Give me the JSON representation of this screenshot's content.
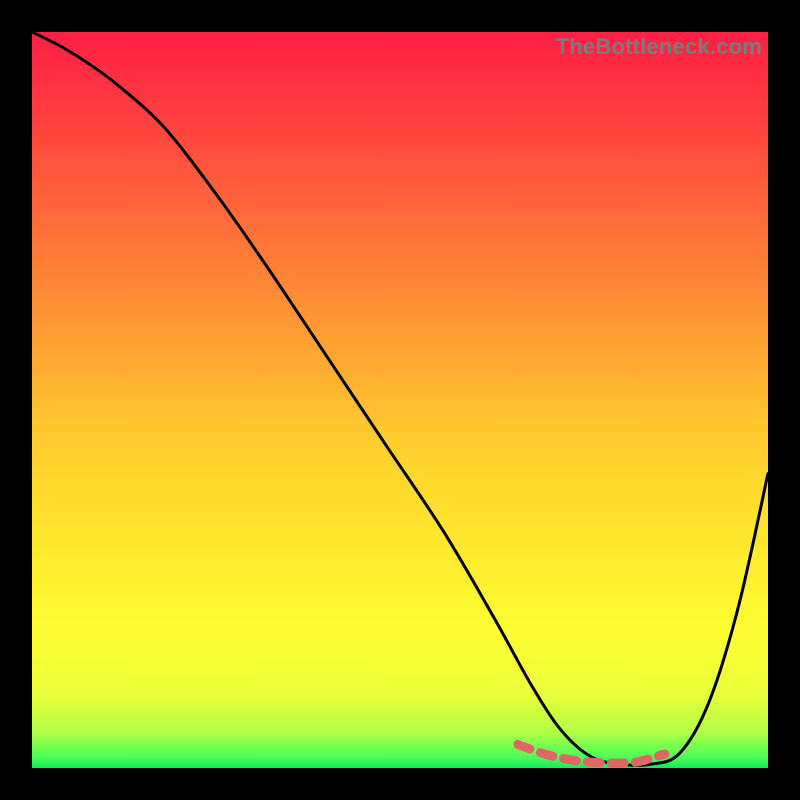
{
  "watermark": "TheBottleneck.com",
  "colors": {
    "background": "#000000",
    "curve": "#000000",
    "segment": "#e06666",
    "gradient_stops": [
      {
        "offset": 0.0,
        "color": "#ff1f44"
      },
      {
        "offset": 0.1,
        "color": "#ff3a40"
      },
      {
        "offset": 0.25,
        "color": "#ff6a3a"
      },
      {
        "offset": 0.4,
        "color": "#ff9933"
      },
      {
        "offset": 0.55,
        "color": "#ffcc2e"
      },
      {
        "offset": 0.7,
        "color": "#ffe92e"
      },
      {
        "offset": 0.82,
        "color": "#fdff33"
      },
      {
        "offset": 0.9,
        "color": "#e8ff3a"
      },
      {
        "offset": 0.95,
        "color": "#b4ff44"
      },
      {
        "offset": 0.985,
        "color": "#4dff58"
      },
      {
        "offset": 1.0,
        "color": "#17e85a"
      }
    ]
  },
  "chart_data": {
    "type": "line",
    "title": "",
    "xlabel": "",
    "ylabel": "",
    "xlim": [
      0,
      100
    ],
    "ylim": [
      0,
      100
    ],
    "grid": false,
    "legend": false,
    "series": [
      {
        "name": "curve",
        "x": [
          0,
          4,
          8,
          12,
          18,
          25,
          32,
          40,
          48,
          56,
          63,
          68,
          72,
          76,
          80,
          84,
          88,
          92,
          96,
          100
        ],
        "y": [
          100,
          98,
          95.5,
          92.5,
          87,
          78,
          68,
          56,
          44,
          32,
          20,
          11,
          5,
          1.5,
          0.5,
          0.5,
          2,
          9,
          22,
          40
        ]
      },
      {
        "name": "highlight-segment",
        "x": [
          66,
          70,
          74,
          78,
          82,
          86
        ],
        "y": [
          3.2,
          1.8,
          1.0,
          0.7,
          0.8,
          1.9
        ]
      }
    ],
    "notes": "x and y are in percent of the plotting area (0 = left/bottom, 100 = right/top). Values are read off the shape of the curve; the image has no numeric axis labels."
  }
}
